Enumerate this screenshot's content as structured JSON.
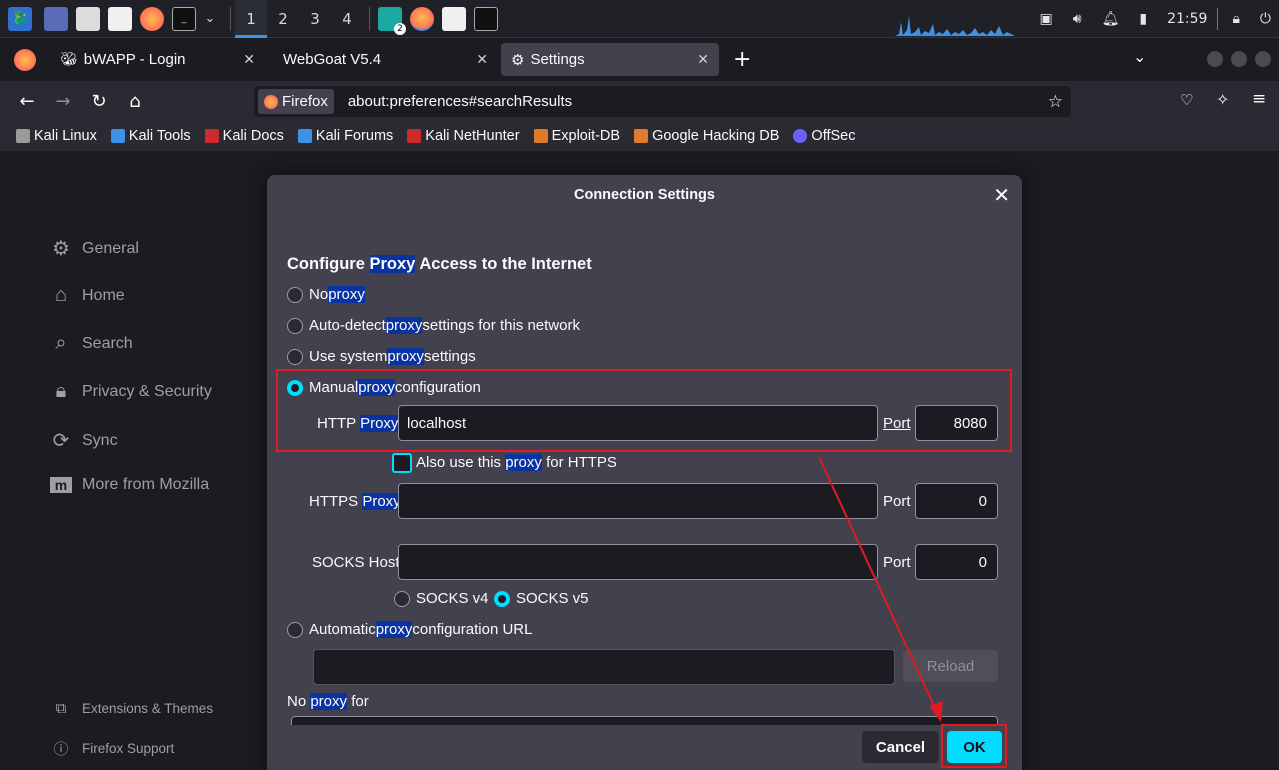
{
  "taskbar": {
    "workspaces": [
      "1",
      "2",
      "3",
      "4"
    ],
    "badge": "2",
    "clock": "21:59"
  },
  "tabs": [
    {
      "label": "bWAPP - Login"
    },
    {
      "label": "WebGoat V5.4"
    },
    {
      "label": "Settings"
    }
  ],
  "urlbar": {
    "identity": "Firefox",
    "url": "about:preferences#searchResults"
  },
  "bookmarks": [
    {
      "label": "Kali Linux",
      "color": "#e6e6e6"
    },
    {
      "label": "Kali Tools",
      "color": "#3d91e6"
    },
    {
      "label": "Kali Docs",
      "color": "#cc2b2b"
    },
    {
      "label": "Kali Forums",
      "color": "#3d91e6"
    },
    {
      "label": "Kali NetHunter",
      "color": "#cc2b2b"
    },
    {
      "label": "Exploit-DB",
      "color": "#e07b2b"
    },
    {
      "label": "Google Hacking DB",
      "color": "#e07b2b"
    },
    {
      "label": "OffSec",
      "color": "#6b63ff"
    }
  ],
  "sidebar": {
    "items": [
      "General",
      "Home",
      "Search",
      "Privacy & Security",
      "Sync",
      "More from Mozilla"
    ],
    "footer": [
      "Extensions & Themes",
      "Firefox Support"
    ]
  },
  "dialog": {
    "title": "Connection Settings",
    "heading_pre": "Configure ",
    "heading_hl": "Proxy",
    "heading_post": " Access to the Internet",
    "proxy_word": "proxy",
    "Proxy_word": "Proxy",
    "opt_no_pre": "No ",
    "opt_auto_pre": "Auto-detect ",
    "opt_auto_post": " settings for this network",
    "opt_system_pre": "Use system ",
    "opt_system_post": " settings",
    "opt_manual_pre": "Manual ",
    "opt_manual_post": " configuration",
    "http_label_pre": "HTTP ",
    "http_value": "localhost",
    "port_label": "Port",
    "http_port": "8080",
    "also_pre": "Also use this ",
    "also_post": " for HTTPS",
    "https_label_pre": "HTTPS ",
    "https_port": "0",
    "socks_label": "SOCKS Host",
    "socks_port": "0",
    "socks_v4": "SOCKS v4",
    "socks_v5": "SOCKS v5",
    "auto_url_pre": "Automatic ",
    "auto_url_post": " configuration URL",
    "reload": "Reload",
    "noproxy_pre": "No ",
    "noproxy_post": " for",
    "cancel": "Cancel",
    "ok": "OK"
  },
  "colors": {
    "accent": "#00ddff",
    "annotation": "#e01b24",
    "highlight": "#0a33a2"
  }
}
